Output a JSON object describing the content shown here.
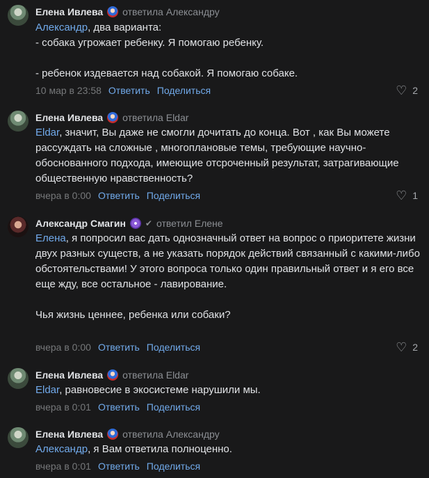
{
  "comments": [
    {
      "author": "Елена Ивлева",
      "replied": "ответила Александру",
      "mention": "Александр",
      "text": ", два варианта:\n- собака угрожает ребенку. Я помогаю ребенку.\n\n- ребенок издевается над собакой. Я помогаю собаке.",
      "time": "10 мар в 23:58",
      "reply_label": "Ответить",
      "share_label": "Поделиться",
      "likes": "2"
    },
    {
      "author": "Елена Ивлева",
      "replied": "ответила Eldar",
      "mention": "Eldar",
      "text": ", значит, Вы даже не смогли дочитать до конца. Вот , как Вы можете рассуждать на сложные , многоплановые темы, требующие научно-обоснованного подхода, имеющие отсроченный результат, затрагивающие общественную нравственность?",
      "time": "вчера в 0:00",
      "reply_label": "Ответить",
      "share_label": "Поделиться",
      "likes": "1"
    },
    {
      "author": "Александр Смагин",
      "replied": "ответил Елене",
      "mention": "Елена",
      "text": ", я попросил вас дать однозначный ответ на вопрос о приоритете жизни двух разных существ, а не указать порядок действий связанный с какими-либо обстоятельствами! У этого вопроса только один правильный ответ и я его все еще жду, все остальное - лавирование.\n\nЧья жизнь ценнее, ребенка или собаки?",
      "time": "вчера в 0:00",
      "reply_label": "Ответить",
      "share_label": "Поделиться",
      "likes": "2"
    },
    {
      "author": "Елена Ивлева",
      "replied": "ответила Eldar",
      "mention": "Eldar",
      "text": ", равновесие в экосистеме нарушили мы.",
      "time": "вчера в 0:01",
      "reply_label": "Ответить",
      "share_label": "Поделиться",
      "likes": ""
    },
    {
      "author": "Елена Ивлева",
      "replied": "ответила Александру",
      "mention": "Александр",
      "text": ", я Вам ответила полноценно.",
      "time": "вчера в 0:01",
      "reply_label": "Ответить",
      "share_label": "Поделиться",
      "likes": ""
    }
  ]
}
